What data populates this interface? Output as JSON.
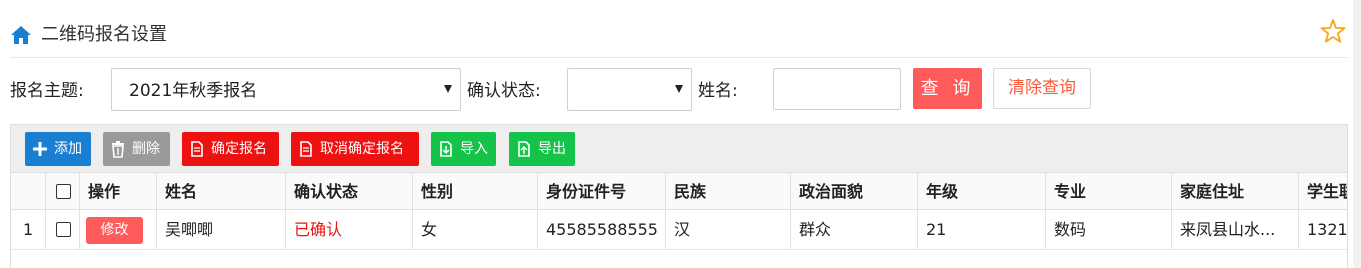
{
  "header": {
    "title": "二维码报名设置",
    "home_icon": "home-icon",
    "favorite_icon": "star-icon",
    "accent_color": "#1a7fd0"
  },
  "filters": {
    "topic_label": "报名主题:",
    "topic_value": "2021年秋季报名",
    "status_label": "确认状态:",
    "status_value": "",
    "name_label": "姓名:",
    "name_value": "",
    "query_button": "查 询",
    "clear_button": "清除查询"
  },
  "toolbar": {
    "add": "添加",
    "delete": "删除",
    "confirm": "确定报名",
    "cancel_confirm": "取消确定报名",
    "import": "导入",
    "export": "导出"
  },
  "table": {
    "columns": [
      "操作",
      "姓名",
      "确认状态",
      "性别",
      "身份证件号",
      "民族",
      "政治面貌",
      "年级",
      "专业",
      "家庭住址",
      "学生联"
    ],
    "rows": [
      {
        "index": "1",
        "action": "修改",
        "name": "吴唧唧",
        "status": "已确认",
        "gender": "女",
        "id_number": "45585588555",
        "ethnicity": "汉",
        "political": "群众",
        "grade": "21",
        "major": "数码",
        "address": "来凤县山水...",
        "contact": "1321"
      }
    ]
  },
  "colors": {
    "danger": "#ff5b5b",
    "confirm_red": "#ee1111",
    "success_green": "#15c24a",
    "neutral_gray": "#9a9a9a"
  }
}
